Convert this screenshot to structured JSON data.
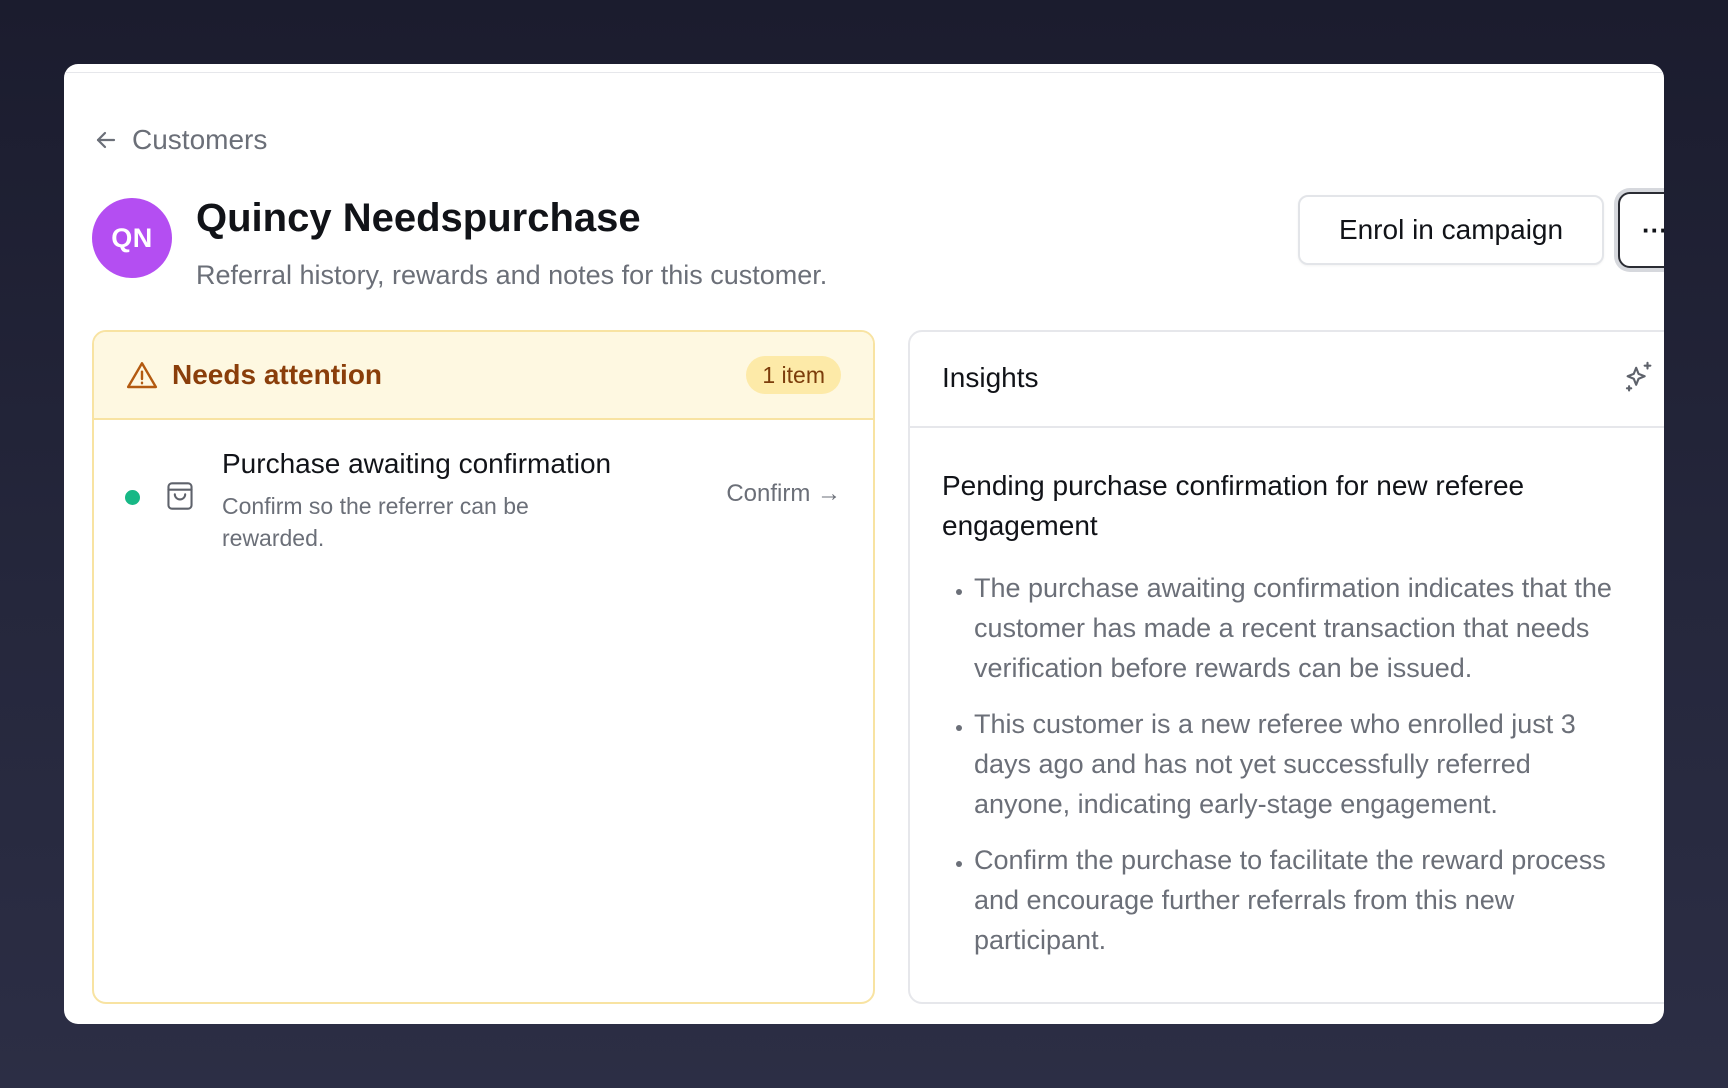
{
  "breadcrumb": {
    "back_label": "Customers"
  },
  "customer": {
    "initials": "QN",
    "name": "Quincy Needspurchase",
    "subtitle": "Referral history, rewards and notes for this customer."
  },
  "actions": {
    "enrol_label": "Enrol in campaign",
    "more_label": "···"
  },
  "attention": {
    "title": "Needs attention",
    "count_label": "1 item",
    "items": [
      {
        "title": "Purchase awaiting confirmation",
        "description": "Confirm so the referrer can be rewarded.",
        "action_label": "Confirm →",
        "status_color": "#17b886",
        "icon": "shopping-bag-icon"
      }
    ]
  },
  "insights": {
    "title": "Insights",
    "icon": "sparkle-icon",
    "heading": "Pending purchase confirmation for new referee engagement",
    "bullets": [
      "The purchase awaiting confirmation indicates that the customer has made a recent transaction that needs verification before rewards can be issued.",
      "This customer is a new referee who enrolled just 3 days ago and has not yet successfully referred anyone, indicating early-stage engagement.",
      "Confirm the purchase to facilitate the reward process and encourage further referrals from this new participant."
    ]
  },
  "colors": {
    "avatar": "#b44ef2",
    "attention_text": "#8a3e0a",
    "attention_background": "#fef8e1",
    "attention_border": "#f8e3a2",
    "status_dot": "#17b886"
  }
}
